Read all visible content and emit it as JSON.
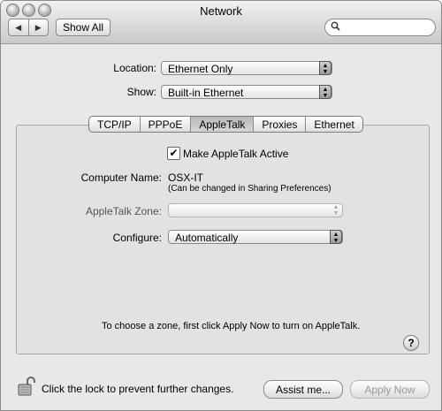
{
  "window": {
    "title": "Network"
  },
  "toolbar": {
    "back_glyph": "◀",
    "forward_glyph": "▶",
    "show_all_label": "Show All",
    "search_placeholder": "",
    "search_icon": "magnifier-icon"
  },
  "location": {
    "label": "Location:",
    "value": "Ethernet Only"
  },
  "show": {
    "label": "Show:",
    "value": "Built-in Ethernet"
  },
  "tabs": [
    {
      "label": "TCP/IP"
    },
    {
      "label": "PPPoE"
    },
    {
      "label": "AppleTalk",
      "selected": true
    },
    {
      "label": "Proxies"
    },
    {
      "label": "Ethernet"
    }
  ],
  "appletalk": {
    "make_active_label": "Make AppleTalk Active",
    "make_active_checked": true,
    "computer_name_label": "Computer Name:",
    "computer_name_value": "OSX-IT",
    "computer_name_hint": "(Can be changed in Sharing Preferences)",
    "zone_label": "AppleTalk Zone:",
    "zone_value": "",
    "configure_label": "Configure:",
    "configure_value": "Automatically",
    "instruction": "To choose a zone, first click Apply Now to turn on AppleTalk."
  },
  "help": {
    "label": "?"
  },
  "footer": {
    "lock_text": "Click the lock to prevent further changes.",
    "assist_label": "Assist me...",
    "apply_label": "Apply Now",
    "apply_enabled": false
  }
}
